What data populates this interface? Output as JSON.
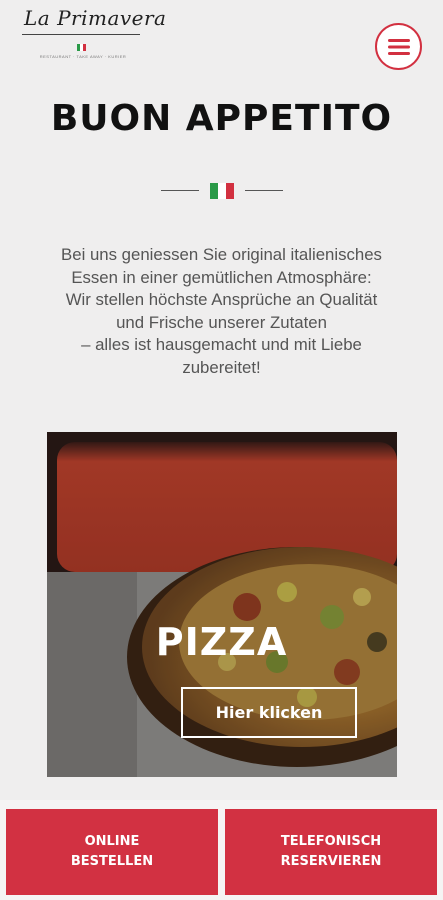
{
  "header": {
    "logo_text": "La Primavera",
    "logo_tagline": "RESTAURANT · TAKE AWAY · KURIER",
    "menu_icon": "hamburger-menu-icon",
    "accent_color": "#d23040"
  },
  "hero": {
    "title": "BUON APPETITO",
    "flag_icon": "italian-flag-icon",
    "intro_lines": [
      "Bei uns geniessen Sie original italienisches",
      "Essen in einer gemütlichen Atmosphäre:",
      "Wir stellen höchste Ansprüche an Qualität",
      "und Frische unserer Zutaten",
      "– alles ist hausgemacht und mit Liebe",
      "zubereitet!"
    ]
  },
  "card": {
    "title": "PIZZA",
    "button_label": "Hier klicken"
  },
  "bottom_bar": {
    "order_line1": "ONLINE",
    "order_line2": "BESTELLEN",
    "reserve_line1": "TELEFONISCH",
    "reserve_line2": "RESERVIEREN",
    "button_color": "#d23142"
  }
}
